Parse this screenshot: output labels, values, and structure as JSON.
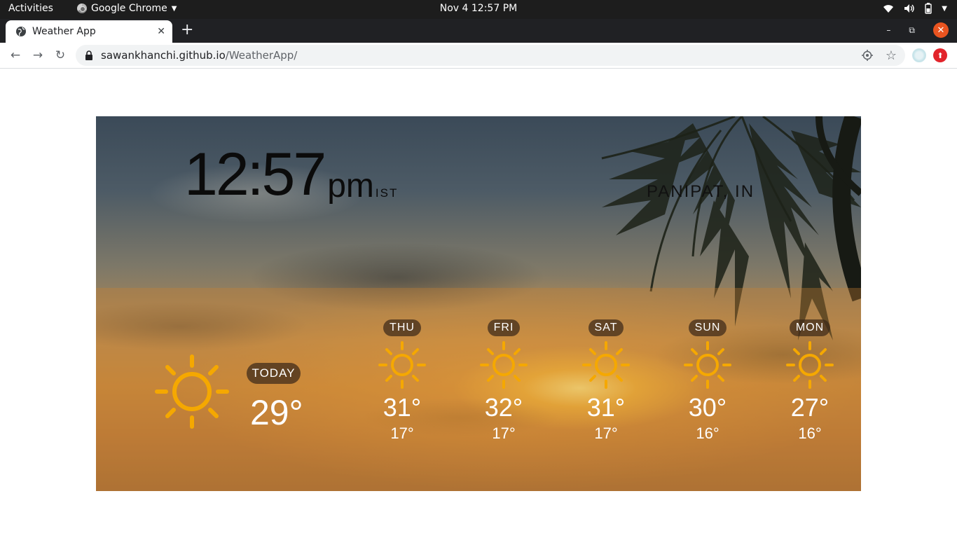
{
  "system_bar": {
    "activities": "Activities",
    "app_name": "Google Chrome",
    "datetime": "Nov 4  12:57 PM"
  },
  "browser": {
    "tab_title": "Weather App",
    "url_host": "sawankhanchi.github.io",
    "url_path": "/WeatherApp/"
  },
  "weather": {
    "time": "12:57",
    "ampm": "pm",
    "timezone": "IST",
    "location": "PANIPAT, IN",
    "today": {
      "label": "TODAY",
      "temp": "29°",
      "icon": "sun-icon"
    },
    "forecast": [
      {
        "day": "THU",
        "high": "31°",
        "low": "17°",
        "icon": "sun-icon"
      },
      {
        "day": "FRI",
        "high": "32°",
        "low": "17°",
        "icon": "sun-icon"
      },
      {
        "day": "SAT",
        "high": "31°",
        "low": "17°",
        "icon": "sun-icon"
      },
      {
        "day": "SUN",
        "high": "30°",
        "low": "16°",
        "icon": "sun-icon"
      },
      {
        "day": "MON",
        "high": "27°",
        "low": "16°",
        "icon": "sun-icon"
      }
    ]
  },
  "colors": {
    "sun_icon": "#f5a800",
    "gnome_bar": "#1d1d1d",
    "tab_strip": "#202124",
    "close_button": "#e95420"
  }
}
